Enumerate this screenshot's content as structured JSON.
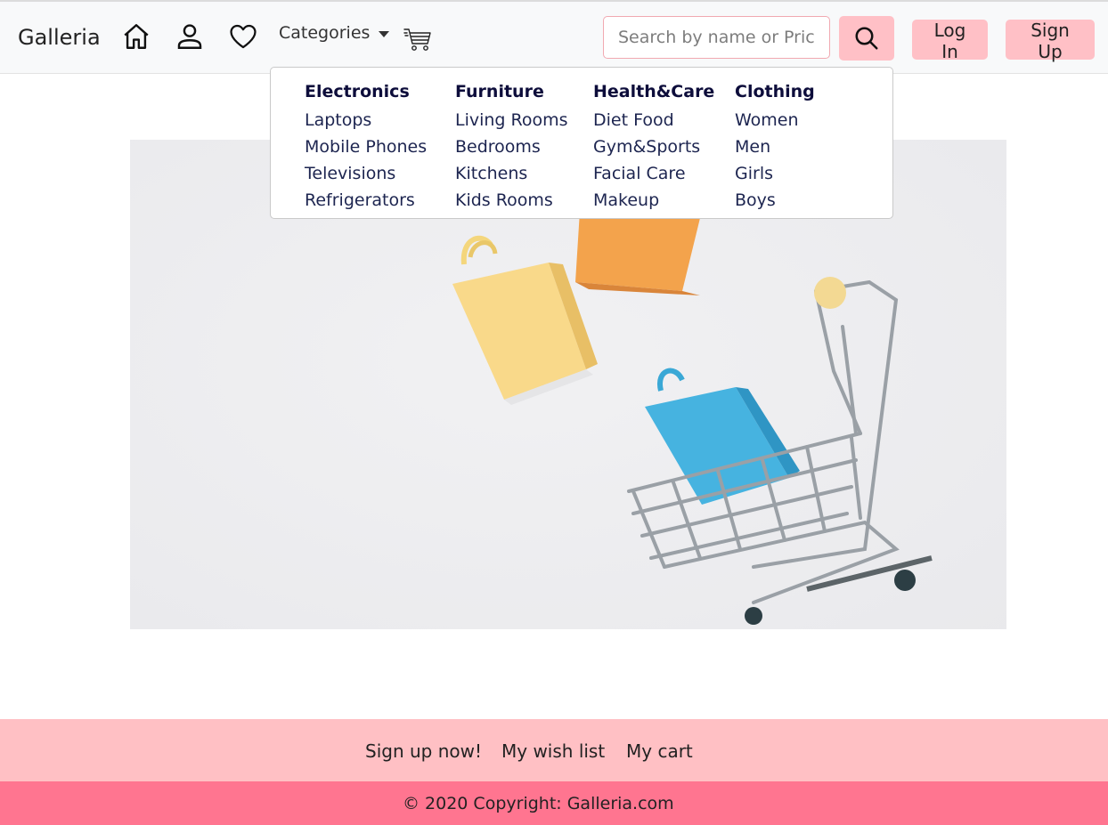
{
  "brand": "Galleria",
  "nav": {
    "icons": [
      "home-icon",
      "user-icon",
      "heart-icon",
      "cart-icon"
    ],
    "categories_label": "Categories"
  },
  "search": {
    "placeholder": "Search by name or Prices"
  },
  "auth": {
    "login_label": "Log In",
    "signup_label": "Sign Up"
  },
  "dropdown": {
    "columns": [
      {
        "heading": "Electronics",
        "items": [
          "Laptops",
          "Mobile Phones",
          "Televisions",
          "Refrigerators"
        ]
      },
      {
        "heading": "Furniture",
        "items": [
          "Living Rooms",
          "Bedrooms",
          "Kitchens",
          "Kids Rooms"
        ]
      },
      {
        "heading": "Health&Care",
        "items": [
          "Diet Food",
          "Gym&Sports",
          "Facial Care",
          "Makeup"
        ]
      },
      {
        "heading": "Clothing",
        "items": [
          "Women",
          "Men",
          "Girls",
          "Boys"
        ]
      }
    ]
  },
  "footer": {
    "links": [
      "Sign up now!",
      "My wish list",
      "My cart"
    ],
    "copyright": "© 2020 Copyright: Galleria.com"
  },
  "colors": {
    "navbar_bg": "#f8f9fa",
    "button_pink": "#ffc0c6",
    "footer_light": "#ffc0c4",
    "footer_dark": "#ff7590",
    "dropdown_text": "#1d2550"
  }
}
